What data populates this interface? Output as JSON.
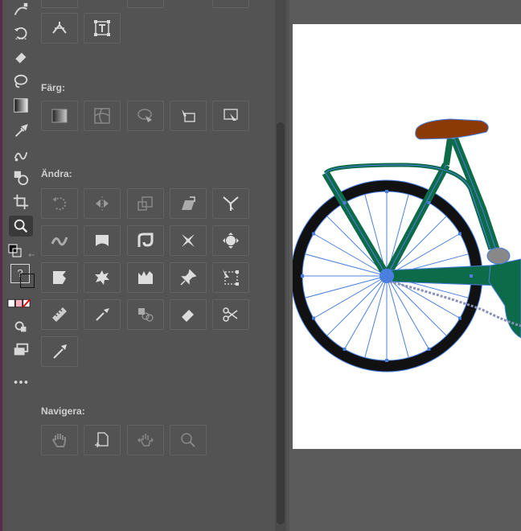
{
  "panel": {
    "sections": {
      "color": "Färg:",
      "modify": "Ändra:",
      "navigate": "Navigera:"
    }
  },
  "toolbar": {
    "tools": [
      "curvature-icon",
      "rotate-icon",
      "eraser-icon",
      "lasso-icon",
      "gradient-icon",
      "eyedropper-icon",
      "blend-icon",
      "shape-builder-icon",
      "artboard-icon",
      "zoom-icon",
      "swap-colors-icon",
      "color-mode-icon",
      "draw-mode-icon",
      "screen-mode-icon",
      "more-tools-icon"
    ],
    "fill_stroke_label": "?"
  },
  "colors": {
    "panel_bg": "#535353",
    "canvas_bg": "#5b5b5b",
    "artboard": "#ffffff",
    "bike_frame": "#0d6b4a",
    "tire": "#111111",
    "seat": "#8b3a06",
    "selection": "#4a7fe0"
  }
}
